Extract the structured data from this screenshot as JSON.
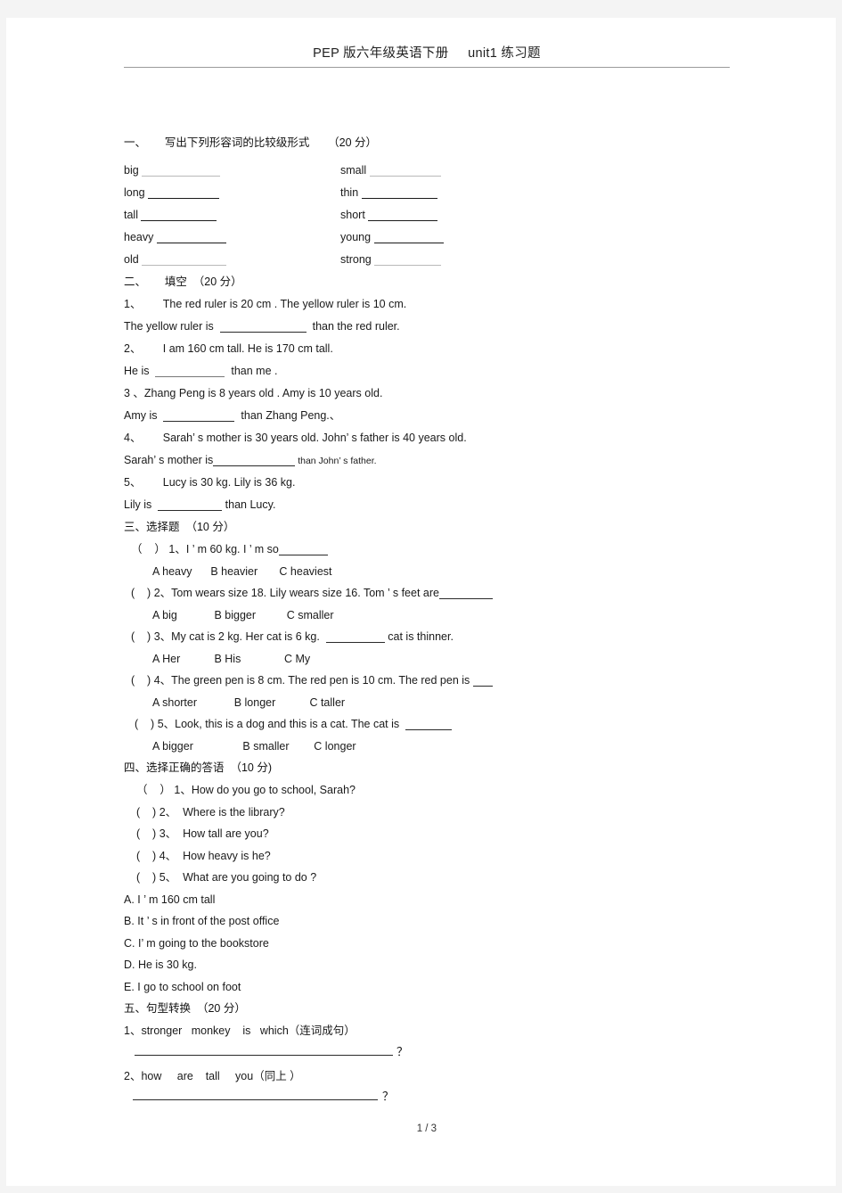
{
  "header": {
    "title": "PEP 版六年级英语下册     unit1 练习题"
  },
  "sections": [
    {
      "heading": "一、      写出下列形容词的比较级形式      （20 分）",
      "type": "adjective-pairs",
      "pairs": [
        {
          "left": "big",
          "right": "small",
          "left_style": "light",
          "right_style": "light"
        },
        {
          "left": "long",
          "right": "thin",
          "left_style": "dark",
          "right_style": "dark"
        },
        {
          "left": "tall",
          "right": "short",
          "left_style": "dark",
          "right_style": "dark"
        },
        {
          "left": "heavy",
          "right": "young",
          "left_style": "dark",
          "right_style": "dark"
        },
        {
          "left": "old",
          "right": "strong",
          "left_style": "light",
          "right_style": "light"
        }
      ]
    },
    {
      "heading": "二、      填空  （20 分）",
      "type": "fill-in-blank",
      "items": [
        {
          "prompt": "1、       The red ruler is 20 cm . The yellow ruler is 10 cm.",
          "answer_before": "The yellow ruler is  ",
          "answer_after": "  than the red ruler."
        },
        {
          "prompt": "2、       I am 160 cm tall. He is 170 cm tall.",
          "answer_before": "He is  ",
          "answer_after": "  than me ."
        },
        {
          "prompt": "3 、Zhang Peng is 8 years old . Amy is 10 years old.",
          "answer_before": "Amy is  ",
          "answer_after": "  than Zhang Peng.、"
        },
        {
          "prompt": "4、       Sarah’ s mother is 30 years old. John’ s father is 40 years old.",
          "answer_before": "Sarah’ s mother is",
          "answer_after": " than John’ s father."
        },
        {
          "prompt": "5、       Lucy is 30 kg. Lily is 36 kg.",
          "answer_before": "Lily is  ",
          "answer_after": " than Lucy."
        }
      ]
    },
    {
      "heading": "三、选择题  （10 分）",
      "type": "multiple-choice",
      "items": [
        {
          "bracket": "（    ）",
          "question_before": " 1、I ’ m 60 kg. I ’ m so",
          "question_after": "",
          "options": "A heavy      B heavier       C heaviest"
        },
        {
          "bracket": "(    )",
          "question_before": " 2、Tom wears size 18. Lily wears size 16. Tom ’ s feet are",
          "question_after": "",
          "options": "A big            B bigger          C smaller"
        },
        {
          "bracket": "(    )",
          "question_before": " 3、My cat is 2 kg. Her cat is 6 kg.  ",
          "question_after": " cat is thinner.",
          "options": "A Her           B His              C My"
        },
        {
          "bracket": "(    )",
          "question_before": " 4、The green pen is 8 cm. The red pen is 10 cm. The red pen is ",
          "question_after": "",
          "options": "A shorter            B longer           C taller"
        },
        {
          "bracket": "(    )",
          "question_before": " 5、Look, this is a dog and this is a cat. The cat is  ",
          "question_after": "",
          "options": "A bigger                B smaller        C longer"
        }
      ]
    },
    {
      "heading": "四、选择正确的答语  （10 分)",
      "type": "matching",
      "items": [
        {
          "bracket": "（    ）",
          "text": " 1、How do you go to school, Sarah?"
        },
        {
          "bracket": "(    )",
          "text": " 2、  Where is the library?"
        },
        {
          "bracket": "(    )",
          "text": " 3、  How tall are you?"
        },
        {
          "bracket": "(    )",
          "text": " 4、  How heavy is he?"
        },
        {
          "bracket": "(    )",
          "text": " 5、  What are you going to do ?"
        }
      ],
      "answers": [
        "A. I ’ m 160 cm tall",
        "B. It ’ s in front of the post office",
        "C. I’ m going to the bookstore",
        "D. He is 30 kg.",
        "E. I go to school on foot"
      ]
    },
    {
      "heading": "五、句型转换  （20 分）",
      "type": "sentence-transform",
      "items": [
        {
          "prompt": "1、stronger   monkey    is   which（连词成句）",
          "mark": "？",
          "line_width": 290
        },
        {
          "prompt": "2、how     are    tall     you（同上 ）",
          "mark": "？",
          "line_width": 275
        }
      ]
    }
  ],
  "footer": {
    "page": "1 / 3"
  }
}
